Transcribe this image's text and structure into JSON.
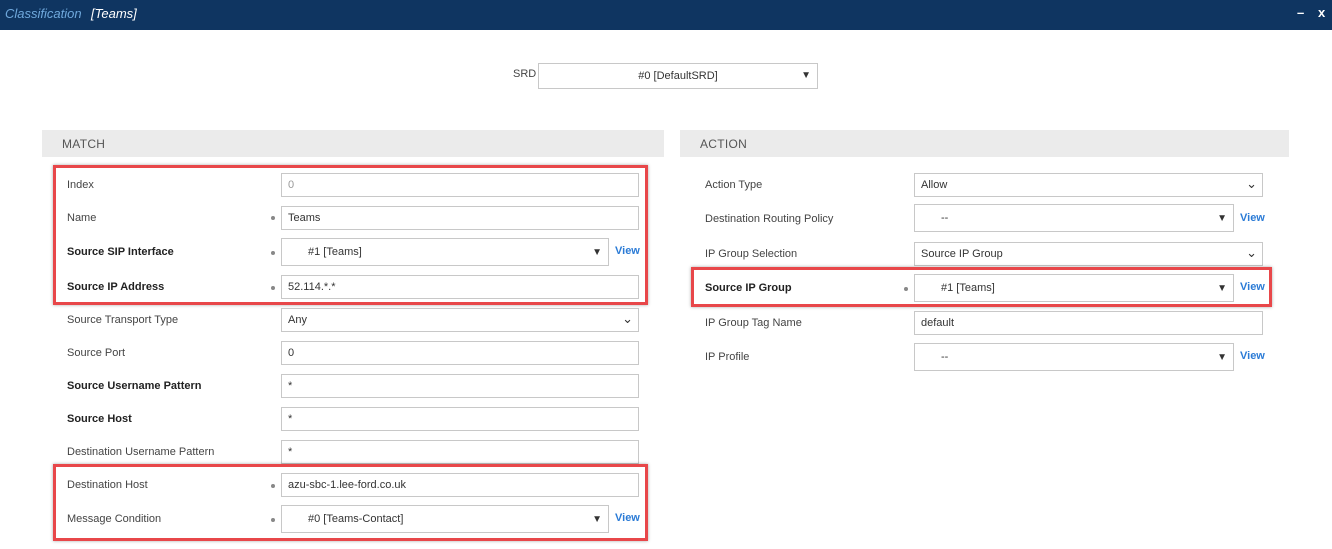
{
  "window": {
    "title_prefix": "Classification",
    "title_name": "[Teams]",
    "minimize": "–",
    "close": "x"
  },
  "srd": {
    "label": "SRD",
    "value": "#0 [DefaultSRD]"
  },
  "match": {
    "header": "MATCH",
    "index": {
      "label": "Index",
      "value": "0"
    },
    "name": {
      "label": "Name",
      "value": "Teams"
    },
    "source_sip_interface": {
      "label": "Source SIP Interface",
      "value": "#1 [Teams]"
    },
    "source_ip_address": {
      "label": "Source IP Address",
      "value": "52.114.*.*"
    },
    "source_transport_type": {
      "label": "Source Transport Type",
      "value": "Any"
    },
    "source_port": {
      "label": "Source Port",
      "value": "0"
    },
    "source_username_pattern": {
      "label": "Source Username Pattern",
      "value": "*"
    },
    "source_host": {
      "label": "Source Host",
      "value": "*"
    },
    "destination_username_pattern": {
      "label": "Destination Username Pattern",
      "value": "*"
    },
    "destination_host": {
      "label": "Destination Host",
      "value": "azu-sbc-1.lee-ford.co.uk"
    },
    "message_condition": {
      "label": "Message Condition",
      "value": "#0 [Teams-Contact]"
    }
  },
  "action": {
    "header": "ACTION",
    "action_type": {
      "label": "Action Type",
      "value": "Allow"
    },
    "destination_routing_policy": {
      "label": "Destination Routing Policy",
      "value": "--"
    },
    "ip_group_selection": {
      "label": "IP Group Selection",
      "value": "Source IP Group"
    },
    "source_ip_group": {
      "label": "Source IP Group",
      "value": "#1 [Teams]"
    },
    "ip_group_tag_name": {
      "label": "IP Group Tag Name",
      "value": "default"
    },
    "ip_profile": {
      "label": "IP Profile",
      "value": "--"
    }
  },
  "view_link": "View",
  "highlight_color": "#e8474a",
  "titlebar_color": "#0f3561"
}
